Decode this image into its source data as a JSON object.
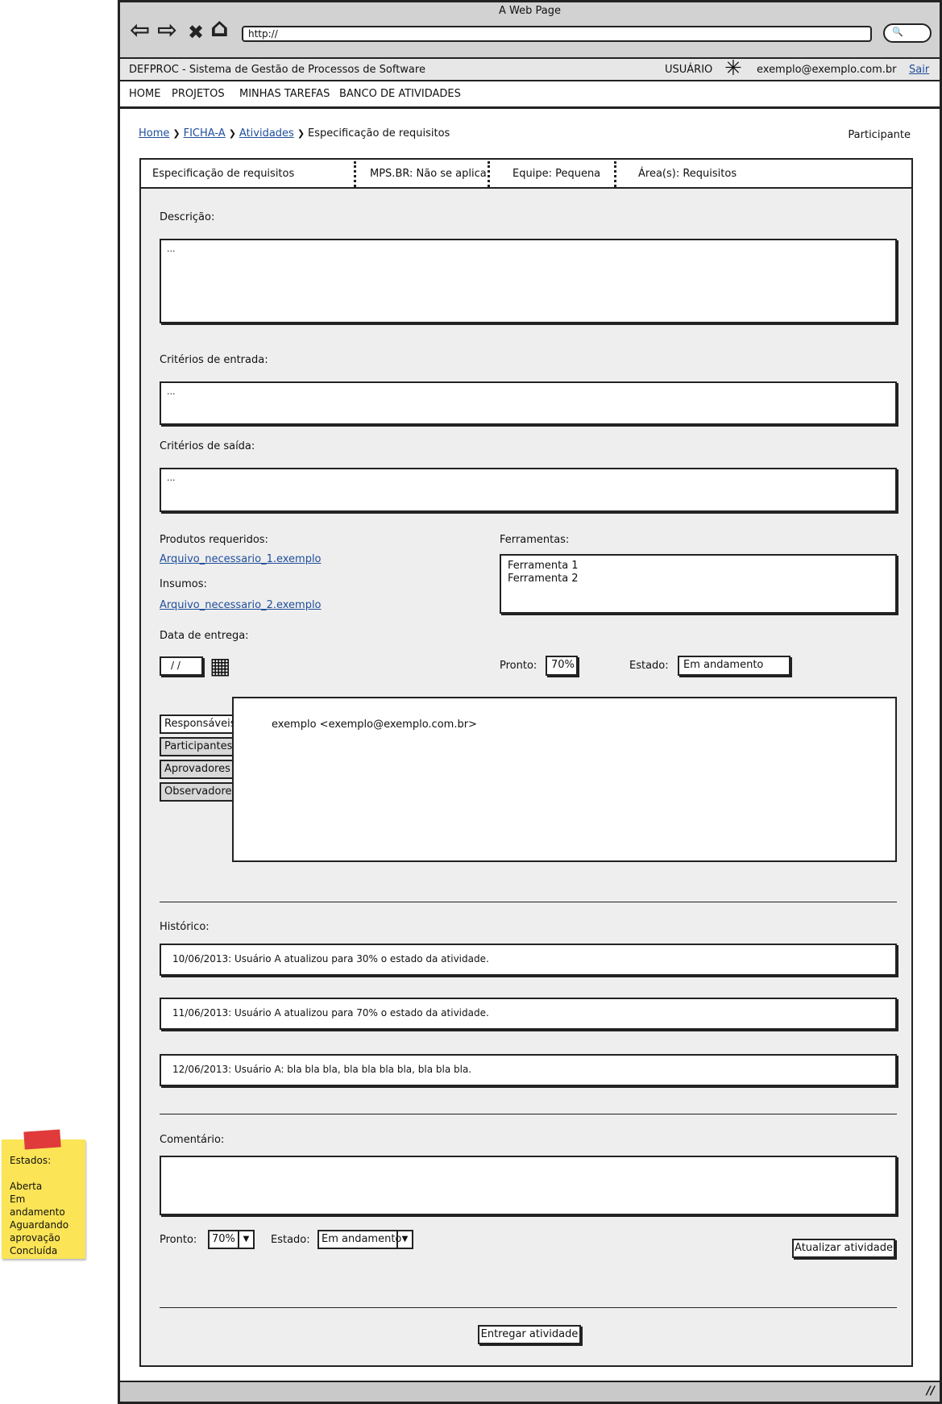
{
  "browser": {
    "title": "A Web Page",
    "url": "http://",
    "back_icon": "⇦",
    "forward_icon": "⇨",
    "stop_icon": "✖",
    "home_icon": "⌂",
    "search_icon": "🔍"
  },
  "header": {
    "app_title": "DEFPROC - Sistema de Gestão de Processos de Software",
    "user_label": "USUÁRIO",
    "user_icon": "✳",
    "email": "exemplo@exemplo.com.br",
    "logout": "Sair"
  },
  "menu": [
    "HOME",
    "PROJETOS",
    "MINHAS TAREFAS",
    "BANCO DE ATIVIDADES"
  ],
  "breadcrumb": {
    "links": [
      "Home",
      "FICHA-A",
      "Atividades"
    ],
    "current": "Especificação de requisitos",
    "separator": "❯"
  },
  "role": "Participante",
  "infobar": [
    "Especificação de requisitos",
    "MPS.BR: Não se aplica",
    "Equipe: Pequena",
    "Área(s): Requisitos"
  ],
  "form": {
    "descricao_label": "Descrição:",
    "descricao_value": "...",
    "entrada_label": "Critérios de entrada:",
    "entrada_value": "...",
    "saida_label": "Critérios de saída:",
    "saida_value": "...",
    "produtos_label": "Produtos requeridos:",
    "produto_link": "Arquivo_necessario_1.exemplo",
    "insumos_label": "Insumos:",
    "insumo_link": "Arquivo_necessario_2.exemplo",
    "ferramentas_label": "Ferramentas:",
    "ferramentas": [
      "Ferramenta 1",
      "Ferramenta 2"
    ],
    "data_label": "Data de entrega:",
    "data_value": "/ /",
    "calendar_icon": "▦",
    "pronto_label": "Pronto:",
    "pronto_value": "70%",
    "estado_label": "Estado:",
    "estado_value": "Em andamento"
  },
  "tabs": {
    "items": [
      "Responsáveis",
      "Participantes",
      "Aprovadores",
      "Observadores"
    ],
    "active_content": "exemplo <exemplo@exemplo.com.br>"
  },
  "historico": {
    "label": "Histórico:",
    "entries": [
      "10/06/2013: Usuário A atualizou para 30% o estado da atividade.",
      "11/06/2013: Usuário A atualizou para 70% o estado da atividade.",
      "12/06/2013: Usuário A: bla bla bla, bla bla bla bla, bla bla bla."
    ]
  },
  "comentario": {
    "label": "Comentário:",
    "pronto_label": "Pronto:",
    "pronto_value": "70%",
    "estado_label": "Estado:",
    "estado_value": "Em andamento",
    "dropdown_icon": "▼",
    "update_button": "Atualizar atividade"
  },
  "deliver_button": "Entregar atividade",
  "resize_icon": "//",
  "sticky_note": {
    "title": "Estados:",
    "items": [
      "Aberta",
      "Em andamento",
      "Aguardando aprovação",
      "Concluída"
    ]
  }
}
